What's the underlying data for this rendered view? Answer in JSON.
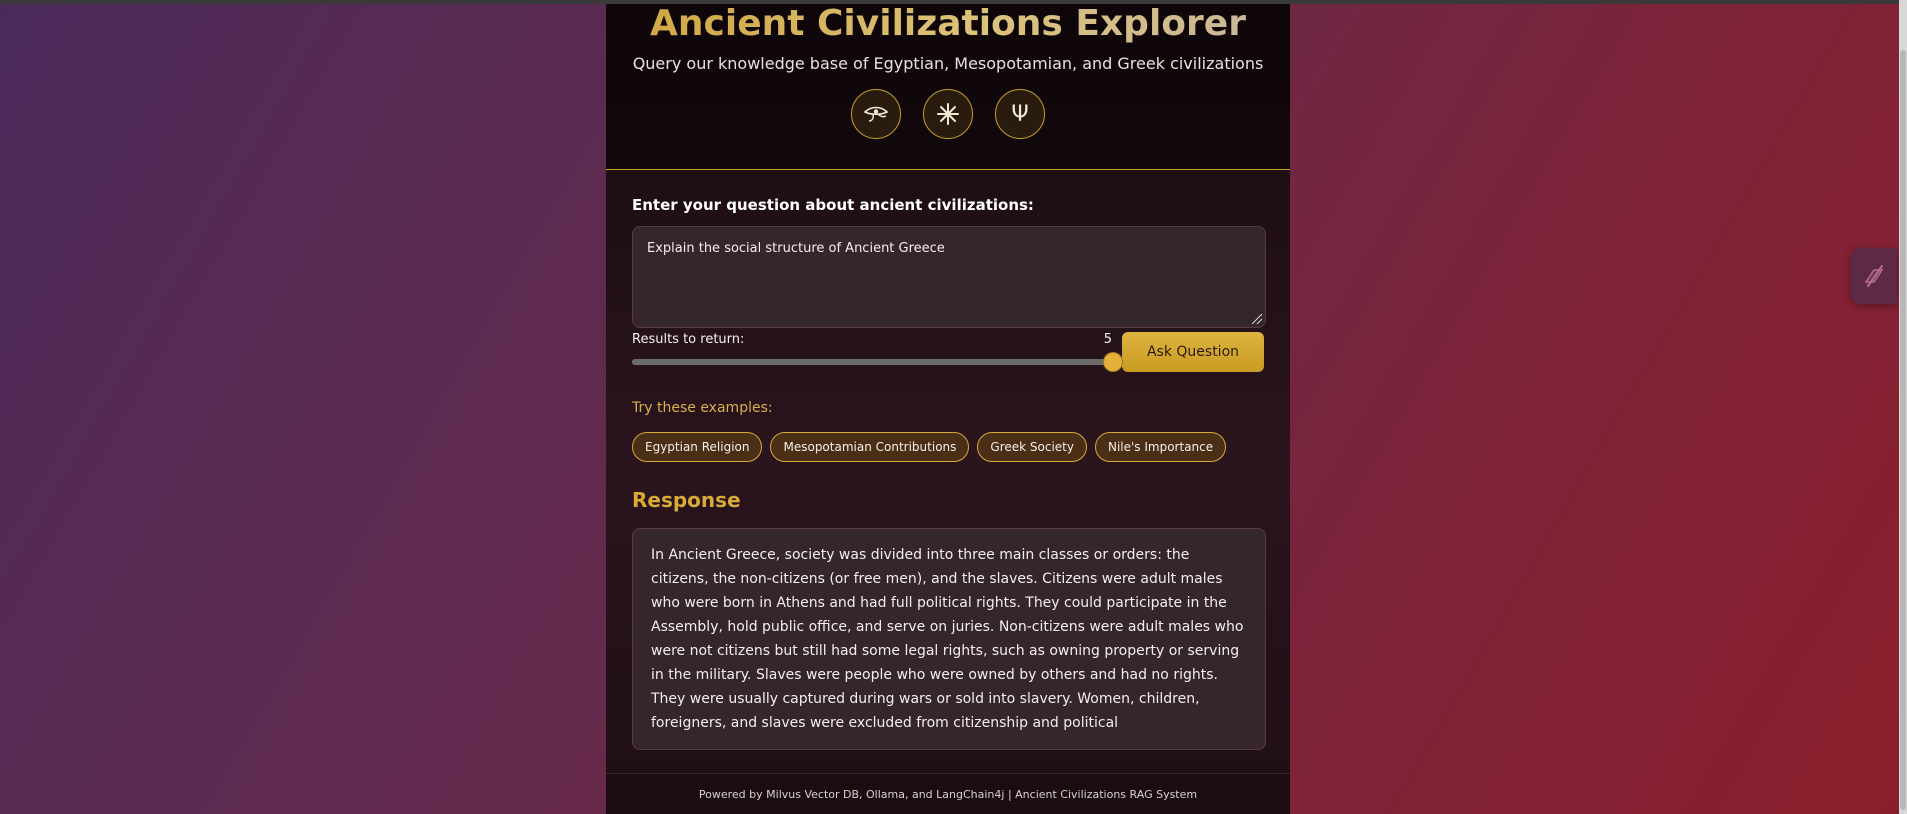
{
  "header": {
    "title": "Ancient Civilizations Explorer",
    "subtitle": "Query our knowledge base of Egyptian, Mesopotamian, and Greek civilizations",
    "icons": [
      {
        "name": "eye-of-horus-icon",
        "glyph": "𓂀"
      },
      {
        "name": "sun-disc-icon",
        "glyph": "✱"
      },
      {
        "name": "trident-icon",
        "glyph": "Ψ"
      }
    ]
  },
  "form": {
    "question_label": "Enter your question about ancient civilizations:",
    "question_value": "Explain the social structure of Ancient Greece",
    "results_label": "Results to return:",
    "results_value": "5",
    "ask_button": "Ask Question"
  },
  "examples": {
    "title": "Try these examples:",
    "items": [
      "Egyptian Religion",
      "Mesopotamian Contributions",
      "Greek Society",
      "Nile's Importance"
    ]
  },
  "response": {
    "title": "Response",
    "text": "In Ancient Greece, society was divided into three main classes or orders: the citizens, the non-citizens (or free men), and the slaves. Citizens were adult males who were born in Athens and had full political rights. They could participate in the Assembly, hold public office, and serve on juries. Non-citizens were adult males who were not citizens but still had some legal rights, such as owning property or serving in the military. Slaves were people who were owned by others and had no rights. They were usually captured during wars or sold into slavery. Women, children, foreigners, and slaves were excluded from citizenship and political"
  },
  "footer": {
    "text": "Powered by Milvus Vector DB, Ollama, and LangChain4j | Ancient Civilizations RAG System"
  },
  "theme": {
    "accent": "#d8aa36",
    "panel": "#150a0f"
  }
}
